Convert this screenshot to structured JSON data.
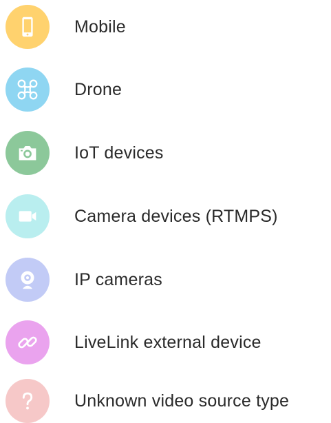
{
  "source_types": [
    {
      "label": "Mobile",
      "icon": "mobile-phone-icon",
      "color": "#FFD26E"
    },
    {
      "label": "Drone",
      "icon": "drone-icon",
      "color": "#8FD6F2"
    },
    {
      "label": "IoT devices",
      "icon": "camera-icon",
      "color": "#8CC89A"
    },
    {
      "label": "Camera devices (RTMPS)",
      "icon": "video-camera-icon",
      "color": "#B9EEEF"
    },
    {
      "label": "IP cameras",
      "icon": "webcam-icon",
      "color": "#C2CBF6"
    },
    {
      "label": "LiveLink external device",
      "icon": "link-icon",
      "color": "#EAA3EE"
    },
    {
      "label": "Unknown video source type",
      "icon": "question-mark-icon",
      "color": "#F6C8C8"
    }
  ]
}
